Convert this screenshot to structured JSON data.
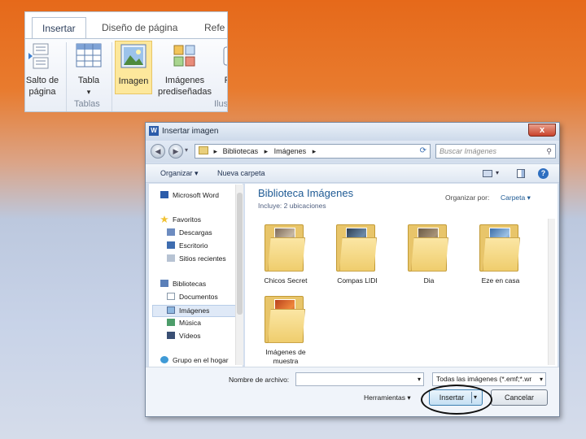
{
  "ribbon": {
    "tabs": [
      "Insertar",
      "Diseño de página",
      "Refe"
    ],
    "buttons": {
      "salto_line1": "Salto de",
      "salto_line2": "página",
      "tabla": "Tabla",
      "tabla_arrow": "▾",
      "imagen": "Imagen",
      "imagenes_line1": "Imágenes",
      "imagenes_line2": "prediseñadas",
      "formas": "Fo"
    },
    "groups": {
      "tablas": "Tablas",
      "ilustraciones": "Ilus"
    }
  },
  "dialog": {
    "title": "Insertar imagen",
    "close": "x",
    "address": {
      "segments": [
        "Bibliotecas",
        "Imágenes"
      ],
      "sep": "▸"
    },
    "search_placeholder": "Buscar Imágenes",
    "toolbar": {
      "organize": "Organizar ▾",
      "new_folder": "Nueva carpeta"
    },
    "nav": {
      "items": [
        {
          "label": "Microsoft Word"
        },
        {
          "label": "Favoritos"
        },
        {
          "label": "Descargas"
        },
        {
          "label": "Escritorio"
        },
        {
          "label": "Sitios recientes"
        },
        {
          "label": "Bibliotecas"
        },
        {
          "label": "Documentos"
        },
        {
          "label": "Imágenes"
        },
        {
          "label": "Música"
        },
        {
          "label": "Vídeos"
        },
        {
          "label": "Grupo en el hogar"
        }
      ]
    },
    "library": {
      "title": "Biblioteca Imágenes",
      "subtitle": "Incluye: 2 ubicaciones",
      "arrange_label": "Organizar por:",
      "arrange_value": "Carpeta ▾"
    },
    "folders": [
      {
        "label": "Chicos Secret",
        "label2": ""
      },
      {
        "label": "Compas LIDI",
        "label2": ""
      },
      {
        "label": "Dia",
        "label2": ""
      },
      {
        "label": "Eze en casa",
        "label2": ""
      },
      {
        "label": "Imágenes de",
        "label2": "muestra"
      }
    ],
    "filename_label": "Nombre de archivo:",
    "filename_value": "",
    "filetype_value": "Todas las imágenes (*.emf;*.wr",
    "tools_label": "Herramientas ▾",
    "insert_button": "Insertar",
    "insert_arrow": "▾",
    "cancel_button": "Cancelar"
  }
}
